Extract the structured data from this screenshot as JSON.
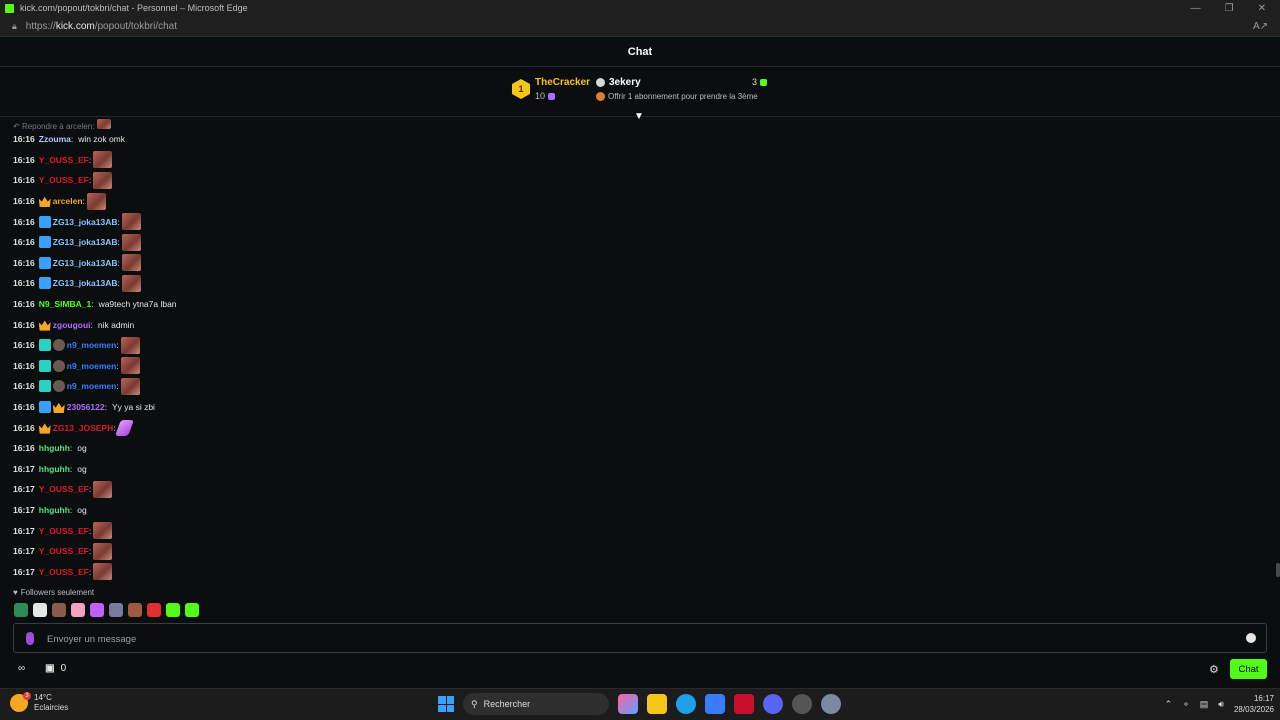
{
  "window": {
    "title": "kick.com/popout/tokbri/chat - Personnel – Microsoft Edge",
    "url_prefix": "https://",
    "url_domain": "kick.com",
    "url_path": "/popout/tokbri/chat"
  },
  "chat": {
    "header": "Chat"
  },
  "leaderboard": {
    "rank": "1",
    "top_user": "TheCracker",
    "top_count": "10",
    "second_user": "3ekery",
    "second_score": "3",
    "offer_text": "Offrir 1 abonnement pour prendre la 3ème"
  },
  "reply_hint": "Repondre à arcelen:",
  "messages": [
    {
      "time": "16:16",
      "user": "Zzouma",
      "color": "#b7c7ff",
      "badges": [],
      "text": "win zok omk",
      "emote": false
    },
    {
      "time": "16:16",
      "user": "Y_OUSS_EF",
      "color": "#e0192a",
      "badges": [],
      "text": "",
      "emote": true
    },
    {
      "time": "16:16",
      "user": "Y_OUSS_EF",
      "color": "#e0192a",
      "badges": [],
      "text": "",
      "emote": true
    },
    {
      "time": "16:16",
      "user": "arcelen",
      "color": "#f5a623",
      "badges": [
        "crown"
      ],
      "text": "",
      "emote": true
    },
    {
      "time": "16:16",
      "user": "ZG13_joka13AB",
      "color": "#8fc3ff",
      "badges": [
        "blue"
      ],
      "text": "",
      "emote": true
    },
    {
      "time": "16:16",
      "user": "ZG13_joka13AB",
      "color": "#8fc3ff",
      "badges": [
        "blue"
      ],
      "text": "",
      "emote": true
    },
    {
      "time": "16:16",
      "user": "ZG13_joka13AB",
      "color": "#8fc3ff",
      "badges": [
        "blue"
      ],
      "text": "",
      "emote": true
    },
    {
      "time": "16:16",
      "user": "ZG13_joka13AB",
      "color": "#8fc3ff",
      "badges": [
        "blue"
      ],
      "text": "",
      "emote": true
    },
    {
      "time": "16:16",
      "user": "N9_SIMBA_1",
      "color": "#53fc18",
      "badges": [],
      "text": "wa9tech ytna7a lban",
      "emote": false
    },
    {
      "time": "16:16",
      "user": "zgougoui",
      "color": "#b06cff",
      "badges": [
        "crown"
      ],
      "text": "nik admin",
      "emote": false
    },
    {
      "time": "16:16",
      "user": "n9_moemen",
      "color": "#3a7bff",
      "badges": [
        "teal",
        "avatar"
      ],
      "text": "",
      "emote": true
    },
    {
      "time": "16:16",
      "user": "n9_moemen",
      "color": "#3a7bff",
      "badges": [
        "teal",
        "avatar"
      ],
      "text": "",
      "emote": true
    },
    {
      "time": "16:16",
      "user": "n9_moemen",
      "color": "#3a7bff",
      "badges": [
        "teal",
        "avatar"
      ],
      "text": "",
      "emote": true
    },
    {
      "time": "16:16",
      "user": "23056122",
      "color": "#b06cff",
      "badges": [
        "blue",
        "crown"
      ],
      "text": "Yy ya si zbi",
      "emote": false
    },
    {
      "time": "16:16",
      "user": "ZG13_JOSEPH",
      "color": "#e0192a",
      "badges": [
        "crown"
      ],
      "text": "",
      "emote": "pink"
    },
    {
      "time": "16:16",
      "user": "hhguhh",
      "color": "#53e08a",
      "badges": [],
      "text": "og",
      "emote": false
    },
    {
      "time": "16:17",
      "user": "hhguhh",
      "color": "#53e08a",
      "badges": [],
      "text": "og",
      "emote": false
    },
    {
      "time": "16:17",
      "user": "Y_OUSS_EF",
      "color": "#e0192a",
      "badges": [],
      "text": "",
      "emote": true
    },
    {
      "time": "16:17",
      "user": "hhguhh",
      "color": "#53e08a",
      "badges": [],
      "text": "og",
      "emote": false
    },
    {
      "time": "16:17",
      "user": "Y_OUSS_EF",
      "color": "#e0192a",
      "badges": [],
      "text": "",
      "emote": true
    },
    {
      "time": "16:17",
      "user": "Y_OUSS_EF",
      "color": "#e0192a",
      "badges": [],
      "text": "",
      "emote": true
    },
    {
      "time": "16:17",
      "user": "Y_OUSS_EF",
      "color": "#e0192a",
      "badges": [],
      "text": "",
      "emote": true
    }
  ],
  "followers_only": "Followers seulement",
  "quick_emotes": [
    "#2e8b57",
    "#e6e6e6",
    "#8a5a4a",
    "#f0a0c0",
    "#c060ff",
    "#7a7a9a",
    "#a05a40",
    "#e03030",
    "#53fc18",
    "#53fc18"
  ],
  "input": {
    "placeholder": "Envoyer un message"
  },
  "bottom": {
    "points": "0",
    "send_label": "Chat"
  },
  "taskbar": {
    "temperature": "14°C",
    "weather": "Eclaircies",
    "weather_badge": "3",
    "search_placeholder": "Rechercher",
    "time": "16:17",
    "date": "28/03/2026"
  }
}
